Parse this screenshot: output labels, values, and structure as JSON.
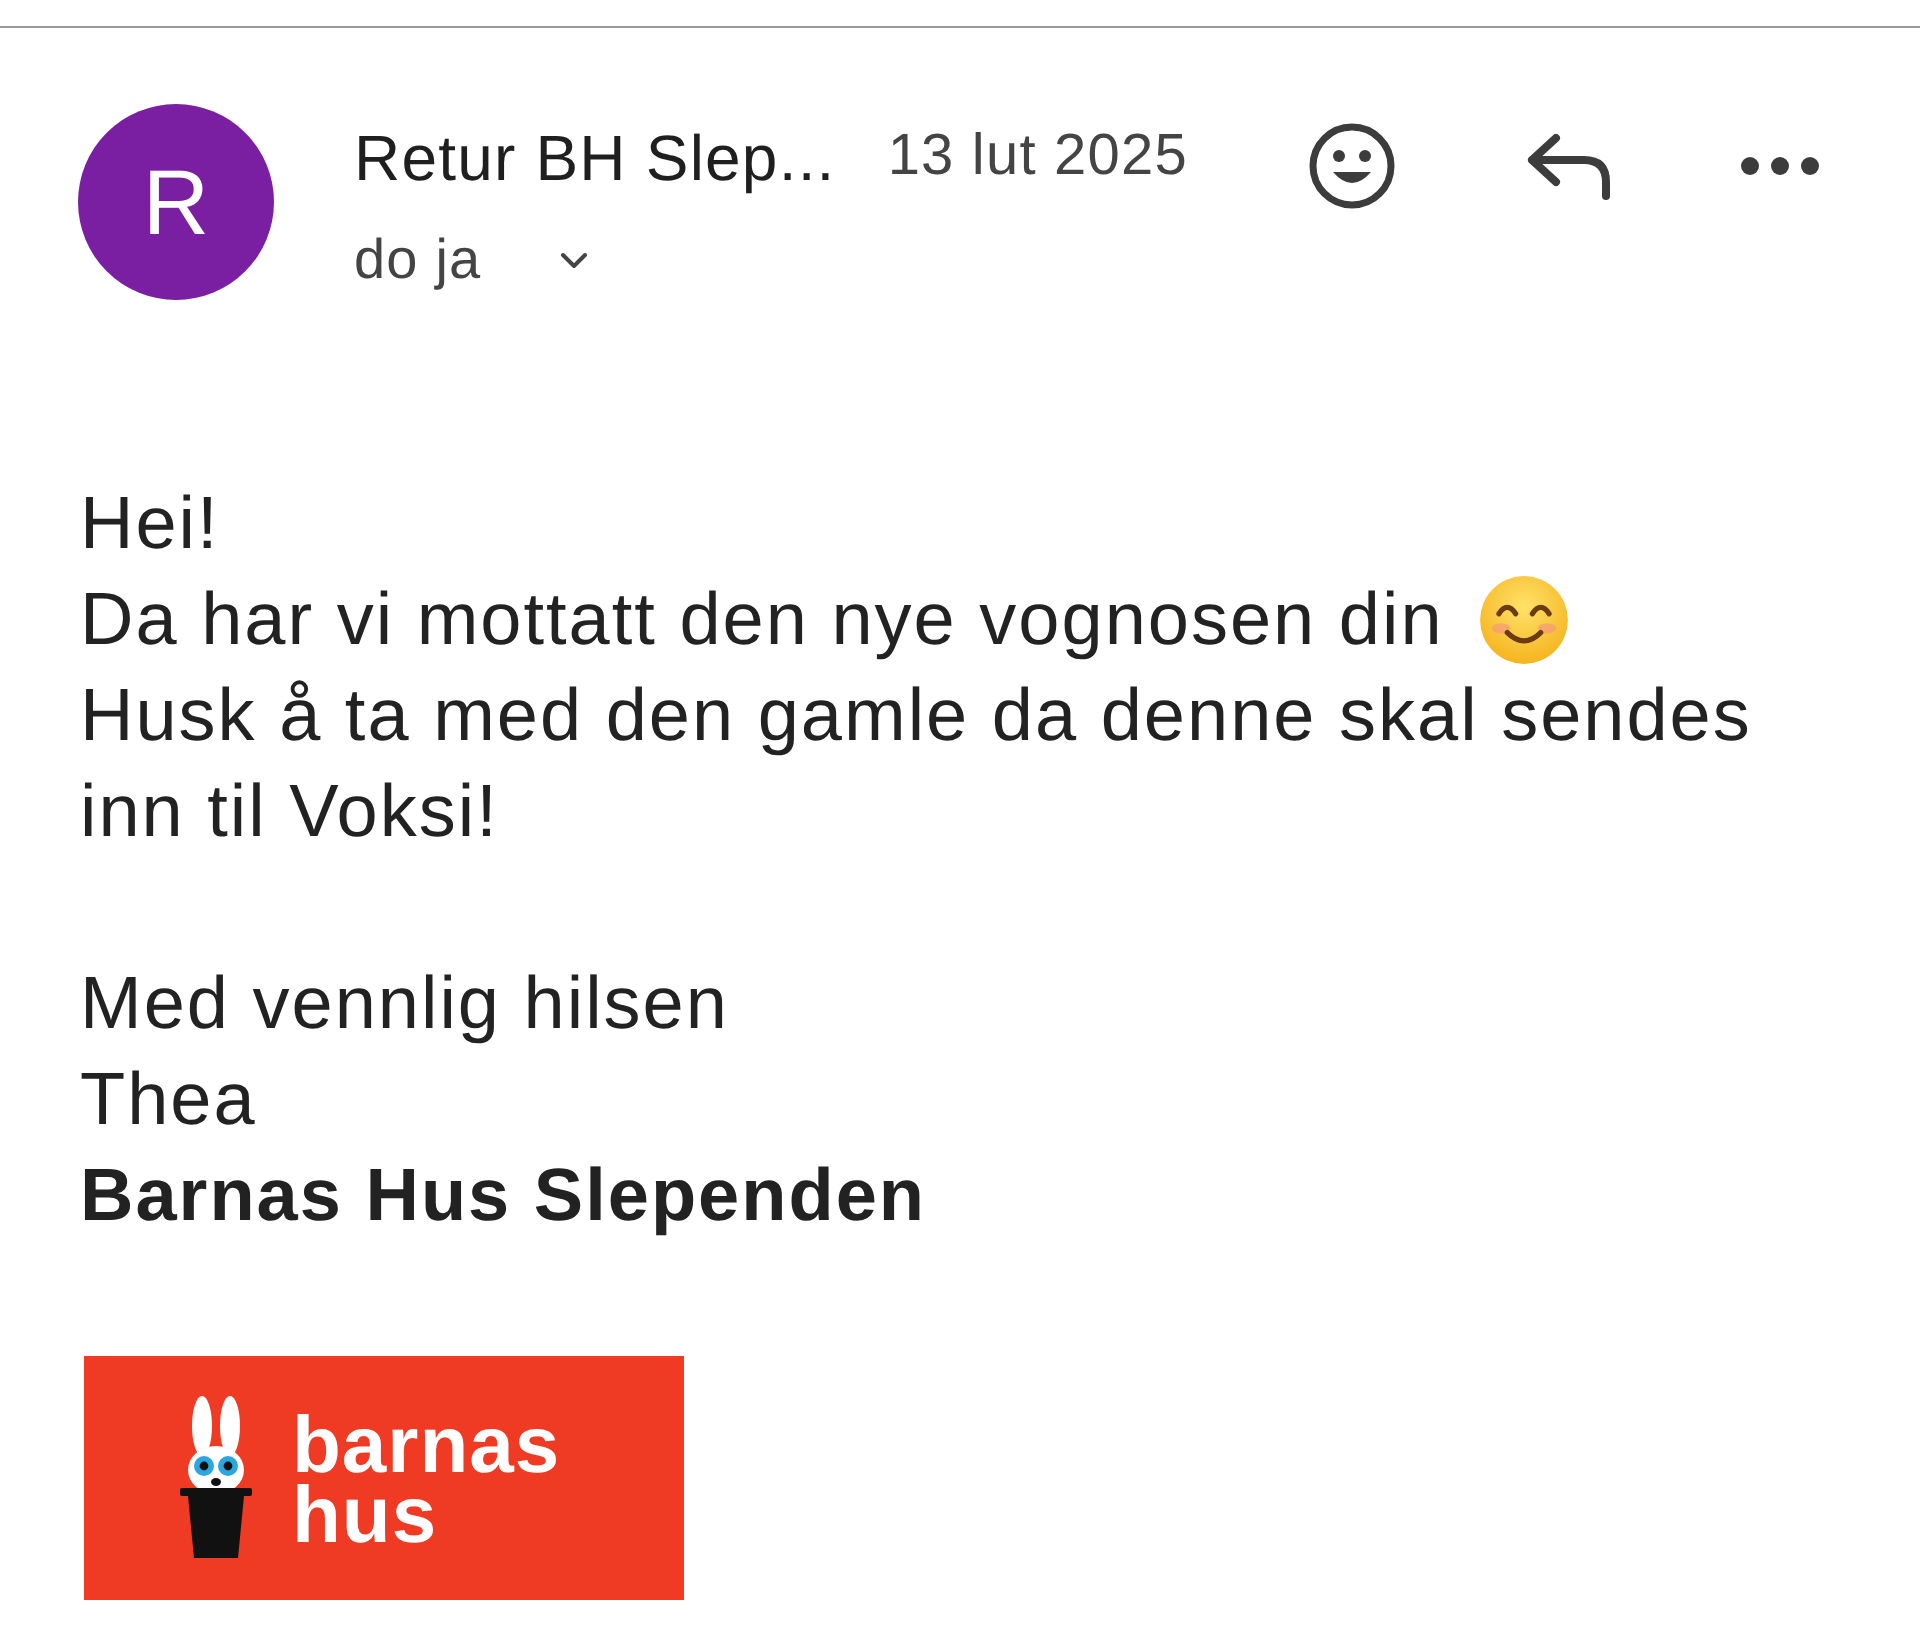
{
  "header": {
    "avatar_letter": "R",
    "sender": "Retur BH Slep...",
    "date": "13 lut 2025",
    "recipient": "do ja"
  },
  "body": {
    "lines": [
      {
        "kind": "text",
        "text": "Hei!"
      },
      {
        "kind": "text_emoji",
        "text": "Da har vi mottatt den nye vognosen din"
      },
      {
        "kind": "text",
        "text": "Husk å ta med den gamle da denne skal sendes inn til Voksi!"
      },
      {
        "kind": "blank"
      },
      {
        "kind": "text",
        "text": "Med vennlig hilsen"
      },
      {
        "kind": "text",
        "text": "Thea"
      },
      {
        "kind": "bold",
        "text": "Barnas Hus Slependen"
      }
    ]
  },
  "logo": {
    "line_1": "barnas",
    "line_2": "hus"
  }
}
